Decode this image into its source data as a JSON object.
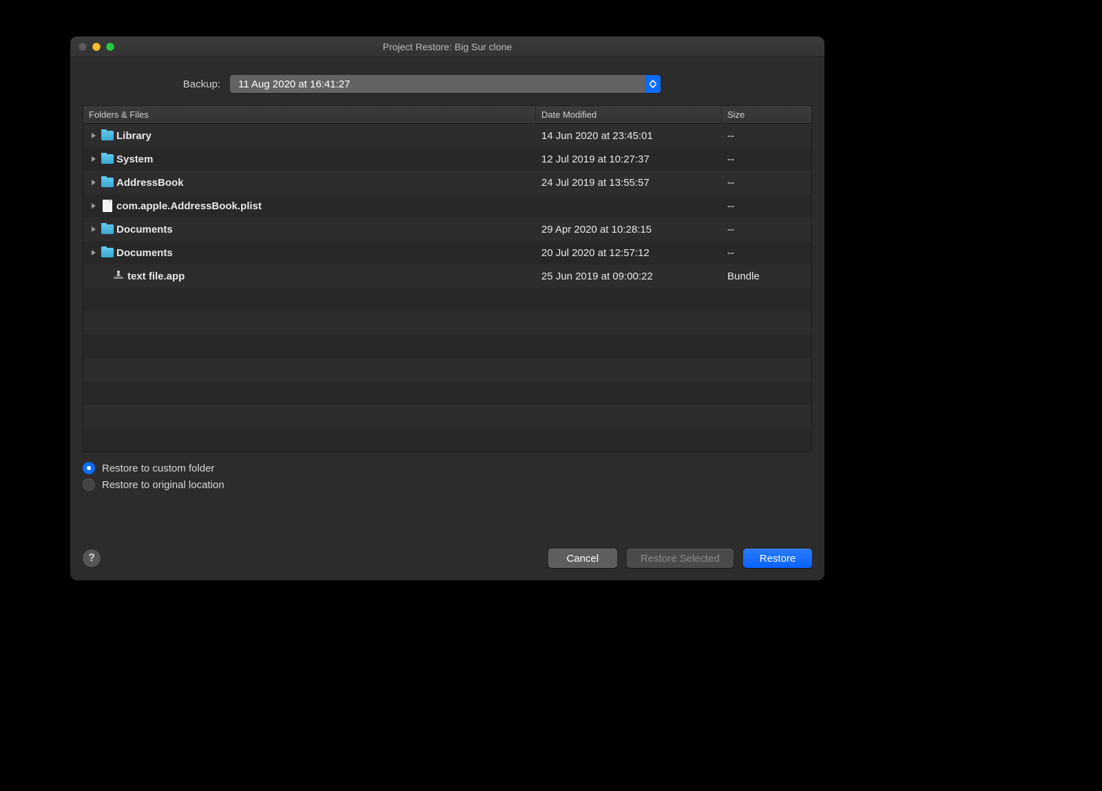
{
  "window": {
    "title": "Project Restore: Big Sur clone"
  },
  "backup": {
    "label": "Backup:",
    "selected": "11 Aug 2020 at 16:41:27"
  },
  "columns": {
    "name": "Folders & Files",
    "date": "Date Modified",
    "size": "Size"
  },
  "rows": [
    {
      "icon": "folder",
      "disclosure": true,
      "indent": 0,
      "name": "Library",
      "date": "14 Jun 2020 at 23:45:01",
      "size": "--"
    },
    {
      "icon": "folder",
      "disclosure": true,
      "indent": 0,
      "name": "System",
      "date": "12 Jul 2019 at 10:27:37",
      "size": "--"
    },
    {
      "icon": "folder",
      "disclosure": true,
      "indent": 0,
      "name": "AddressBook",
      "date": "24 Jul 2019 at 13:55:57",
      "size": "--"
    },
    {
      "icon": "file",
      "disclosure": true,
      "indent": 0,
      "name": "com.apple.AddressBook.plist",
      "date": "",
      "size": "--"
    },
    {
      "icon": "folder",
      "disclosure": true,
      "indent": 0,
      "name": "Documents",
      "date": "29 Apr 2020 at 10:28:15",
      "size": "--"
    },
    {
      "icon": "folder",
      "disclosure": true,
      "indent": 0,
      "name": "Documents",
      "date": "20 Jul 2020 at 12:57:12",
      "size": "--"
    },
    {
      "icon": "app",
      "disclosure": false,
      "indent": 1,
      "name": "text file.app",
      "date": "25 Jun 2019 at 09:00:22",
      "size": "Bundle"
    }
  ],
  "options": {
    "custom": {
      "label": "Restore to custom folder",
      "checked": true
    },
    "original": {
      "label": "Restore to original location",
      "checked": false
    }
  },
  "buttons": {
    "help": "?",
    "cancel": "Cancel",
    "restore_selected": "Restore Selected",
    "restore": "Restore"
  }
}
